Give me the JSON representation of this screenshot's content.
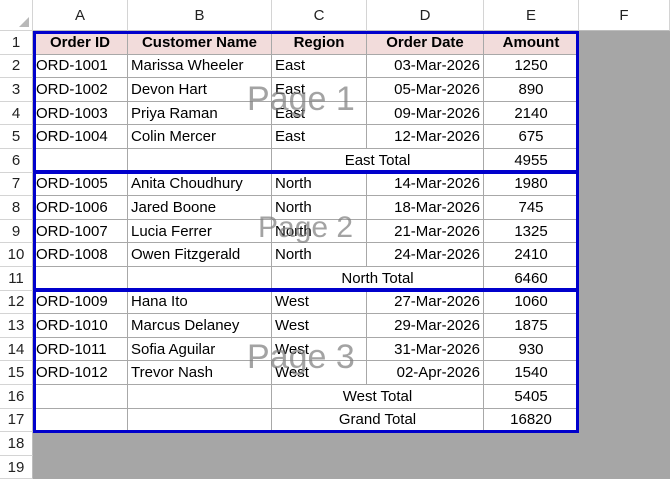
{
  "columns": [
    "A",
    "B",
    "C",
    "D",
    "E",
    "F"
  ],
  "rows": [
    "1",
    "2",
    "3",
    "4",
    "5",
    "6",
    "7",
    "8",
    "9",
    "10",
    "11",
    "12",
    "13",
    "14",
    "15",
    "16",
    "17",
    "18",
    "19"
  ],
  "headers": [
    "Order ID",
    "Customer Name",
    "Region",
    "Order Date",
    "Amount"
  ],
  "orders_east": [
    {
      "id": "ORD-1001",
      "customer": "Marissa Wheeler",
      "region": "East",
      "date": "03-Mar-2026",
      "amount": "1250"
    },
    {
      "id": "ORD-1002",
      "customer": "Devon Hart",
      "region": "East",
      "date": "05-Mar-2026",
      "amount": "890"
    },
    {
      "id": "ORD-1003",
      "customer": "Priya Raman",
      "region": "East",
      "date": "09-Mar-2026",
      "amount": "2140"
    },
    {
      "id": "ORD-1004",
      "customer": "Colin Mercer",
      "region": "East",
      "date": "12-Mar-2026",
      "amount": "675"
    }
  ],
  "east_total": {
    "label": "East Total",
    "amount": "4955"
  },
  "orders_north": [
    {
      "id": "ORD-1005",
      "customer": "Anita Choudhury",
      "region": "North",
      "date": "14-Mar-2026",
      "amount": "1980"
    },
    {
      "id": "ORD-1006",
      "customer": "Jared Boone",
      "region": "North",
      "date": "18-Mar-2026",
      "amount": "745"
    },
    {
      "id": "ORD-1007",
      "customer": "Lucia Ferrer",
      "region": "North",
      "date": "21-Mar-2026",
      "amount": "1325"
    },
    {
      "id": "ORD-1008",
      "customer": "Owen Fitzgerald",
      "region": "North",
      "date": "24-Mar-2026",
      "amount": "2410"
    }
  ],
  "north_total": {
    "label": "North Total",
    "amount": "6460"
  },
  "orders_west": [
    {
      "id": "ORD-1009",
      "customer": "Hana Ito",
      "region": "West",
      "date": "27-Mar-2026",
      "amount": "1060"
    },
    {
      "id": "ORD-1010",
      "customer": "Marcus Delaney",
      "region": "West",
      "date": "29-Mar-2026",
      "amount": "1875"
    },
    {
      "id": "ORD-1011",
      "customer": "Sofia Aguilar",
      "region": "West",
      "date": "31-Mar-2026",
      "amount": "930"
    },
    {
      "id": "ORD-1012",
      "customer": "Trevor Nash",
      "region": "West",
      "date": "02-Apr-2026",
      "amount": "1540"
    }
  ],
  "west_total": {
    "label": "West Total",
    "amount": "5405"
  },
  "grand_total": {
    "label": "Grand Total",
    "amount": "16820"
  },
  "page_labels": [
    "Page 1",
    "Page 2",
    "Page 3"
  ],
  "colors": {
    "header_fill": "#f2dcdb",
    "page_break": "#0000cc",
    "outside_print_area": "#a6a6a6"
  },
  "view": "Page Break Preview"
}
